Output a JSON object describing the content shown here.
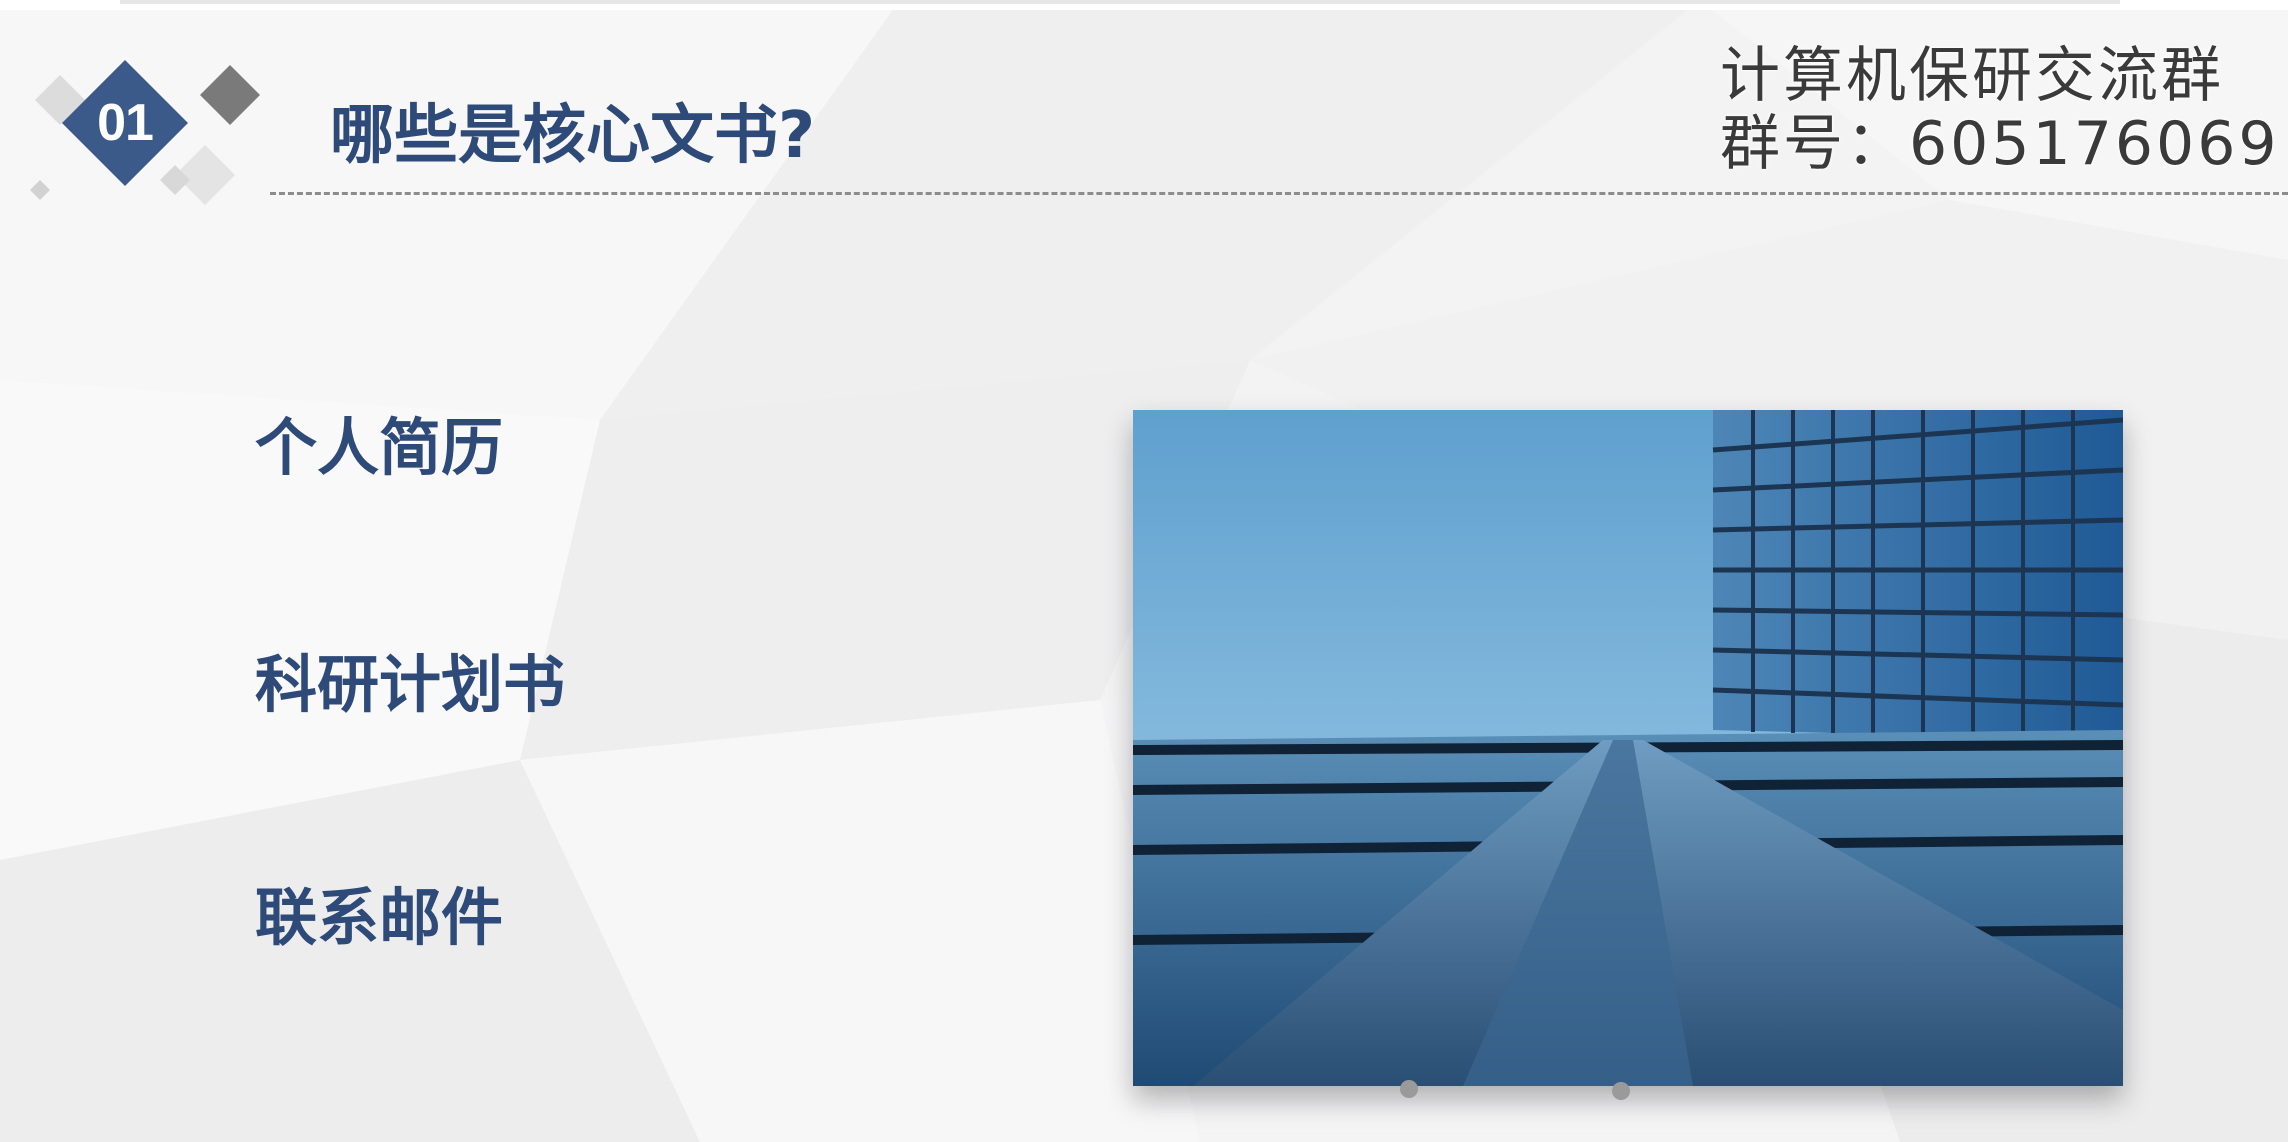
{
  "slide": {
    "section_number": "01",
    "title": "哪些是核心文书?"
  },
  "watermark": {
    "line1": "计算机保研交流群",
    "line2": "群号：605176069"
  },
  "documents": [
    {
      "label": "个人简历"
    },
    {
      "label": "科研计划书"
    },
    {
      "label": "联系邮件"
    }
  ],
  "image": {
    "icon": "glass-building-photo"
  },
  "colors": {
    "accent": "#2e4a78",
    "badge": "#3b5a8a",
    "background": "#f4f4f5"
  }
}
